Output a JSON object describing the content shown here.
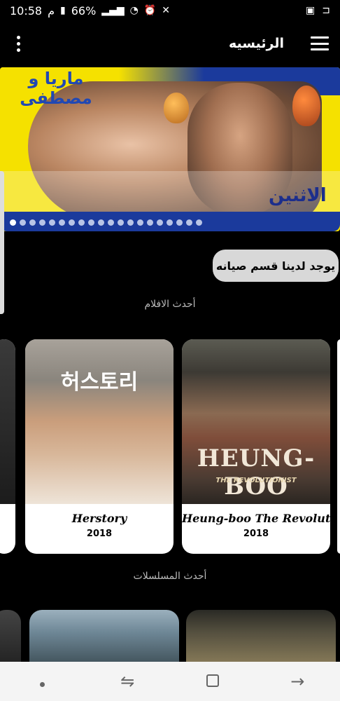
{
  "status_bar": {
    "time": "10:58",
    "suffix": "م",
    "battery": "66%",
    "network": "3G"
  },
  "app_bar": {
    "title": "الرئيسيه"
  },
  "banner": {
    "title": "ماريا و مصطفى",
    "day": "الاثنين",
    "dot_count": 20,
    "active_dot": 0
  },
  "maintenance_chip": "يوجد لدينا قسم صيانه",
  "movies_section": {
    "header": "أحدث الافلام",
    "items": [
      {
        "title": "Herstory",
        "year": "2018",
        "poster_text": "허스토리"
      },
      {
        "title": "Heung-boo The Revolutionist",
        "year": "2018",
        "poster_text": "HEUNG-BOO",
        "poster_subtext": "THE REVOLUTIONIST"
      }
    ]
  },
  "series_section": {
    "header": "أحدث المسلسلات"
  },
  "colors": {
    "background": "#000000",
    "banner_yellow": "#f5e100",
    "banner_blue": "#1b3a9c",
    "chip_bg": "#d8d8d8"
  },
  "icons": {
    "menu": "hamburger-icon",
    "more": "more-vert-icon",
    "nav_home": "home-dot-icon",
    "nav_back": "back-arrow-icon",
    "nav_recents": "recents-icon",
    "nav_switch": "switch-icon"
  }
}
